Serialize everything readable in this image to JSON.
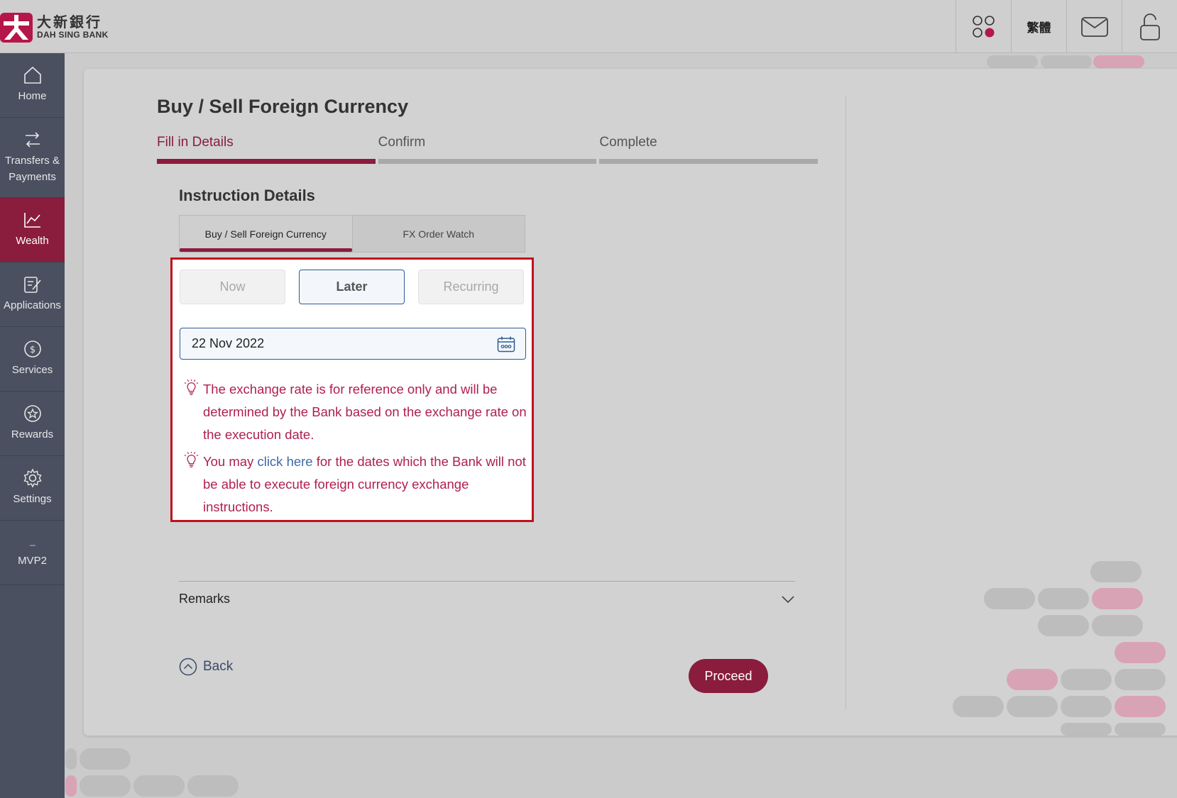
{
  "brand": {
    "name_cn": "大新銀行",
    "name_en": "DAH SING BANK",
    "primary_color": "#8a1c3d"
  },
  "header": {
    "apps_icon": "apps-icon",
    "language_label": "繁體",
    "mail_icon": "mail-icon",
    "logout_icon": "lock-icon"
  },
  "sidebar": {
    "items": [
      {
        "label": "Home",
        "icon": "home-icon"
      },
      {
        "label": "Transfers & Payments",
        "icon": "transfer-icon"
      },
      {
        "label": "Wealth",
        "icon": "chart-icon",
        "active": true
      },
      {
        "label": "Applications",
        "icon": "application-icon"
      },
      {
        "label": "Services",
        "icon": "dollar-icon"
      },
      {
        "label": "Rewards",
        "icon": "star-icon"
      },
      {
        "label": "Settings",
        "icon": "gear-icon"
      },
      {
        "label": "MVP2",
        "icon": "mvp-icon"
      }
    ]
  },
  "page": {
    "title": "Buy / Sell Foreign Currency",
    "steps": [
      {
        "label": "Fill in Details",
        "active": true
      },
      {
        "label": "Confirm"
      },
      {
        "label": "Complete"
      }
    ],
    "section_title": "Instruction Details",
    "subtabs": [
      {
        "label": "Buy / Sell Foreign Currency",
        "active": true
      },
      {
        "label": "FX Order Watch"
      }
    ],
    "timing": {
      "options": [
        "Now",
        "Later",
        "Recurring"
      ],
      "selected": "Later"
    },
    "date": {
      "value": "22 Nov 2022"
    },
    "notes": {
      "note1": "The exchange rate is for reference only and will be determined by the Bank based on the exchange rate on the execution date.",
      "note2_prefix": "You may ",
      "note2_link": "click here",
      "note2_suffix": " for the dates which the Bank will not be able to execute foreign currency exchange instructions."
    },
    "remarks_label": "Remarks",
    "back_label": "Back",
    "proceed_label": "Proceed"
  }
}
